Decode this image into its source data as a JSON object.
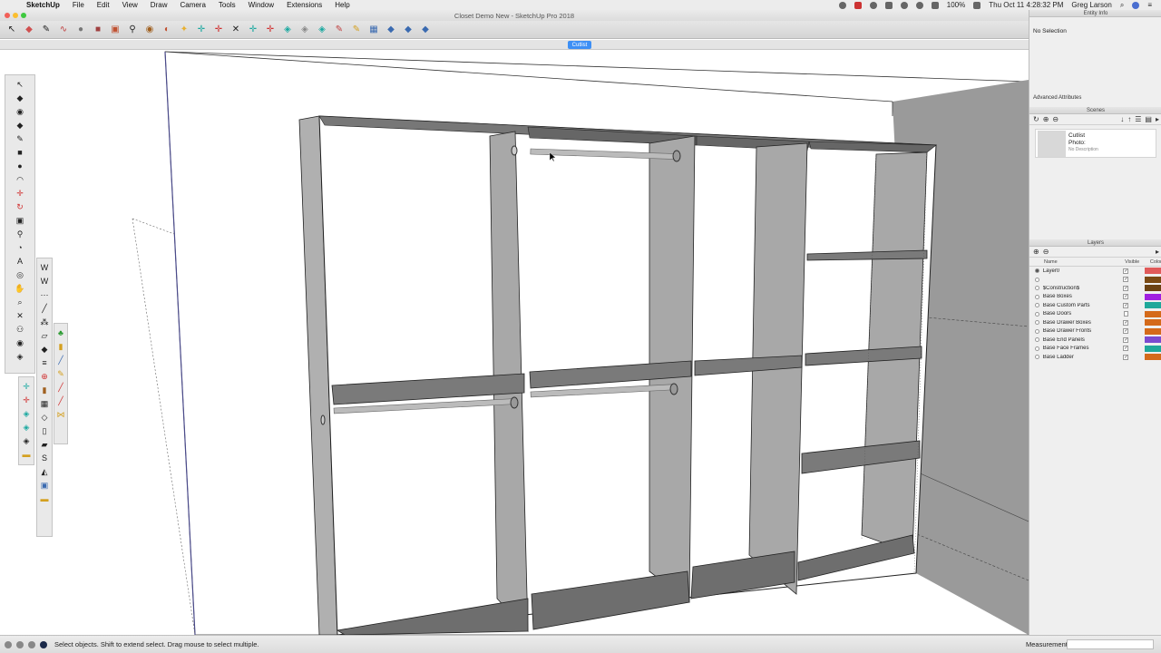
{
  "menubar": {
    "items": [
      {
        "label": "SketchUp",
        "app": true
      },
      {
        "label": "File"
      },
      {
        "label": "Edit"
      },
      {
        "label": "View"
      },
      {
        "label": "Draw"
      },
      {
        "label": "Camera"
      },
      {
        "label": "Tools"
      },
      {
        "label": "Window"
      },
      {
        "label": "Extensions"
      },
      {
        "label": "Help"
      }
    ],
    "battery": "100%",
    "clock": "Thu Oct 11  4:28:32 PM",
    "user": "Greg Larson"
  },
  "window": {
    "title": "Closet Demo New - SketchUp Pro 2018"
  },
  "scene_tab": {
    "label": "Cutlist"
  },
  "tray": {
    "entity_info": {
      "title": "Entity Info",
      "selection": "No Selection",
      "advanced": "Advanced Attributes"
    },
    "scenes": {
      "title": "Scenes",
      "scene_name": "Cutlist",
      "scene_desc": "Photo:",
      "scene_nodesc": "No Description"
    },
    "layers": {
      "title": "Layers",
      "col_name": "Name",
      "col_visible": "Visible",
      "col_color": "Color",
      "rows": [
        {
          "name": "Layer0",
          "visible": true,
          "color": "#e05a5a",
          "active": true
        },
        {
          "name": "",
          "visible": true,
          "color": "#7a4a14",
          "active": false
        },
        {
          "name": "$Construction$",
          "visible": true,
          "color": "#6b4213",
          "active": false
        },
        {
          "name": "Base Boxes",
          "visible": true,
          "color": "#a020e0",
          "active": false
        },
        {
          "name": "Base Custom Parts",
          "visible": true,
          "color": "#1fa89a",
          "active": false
        },
        {
          "name": "Base Doors",
          "visible": false,
          "color": "#d46a1a",
          "active": false
        },
        {
          "name": "Base Drawer Boxes",
          "visible": true,
          "color": "#d46a1a",
          "active": false
        },
        {
          "name": "Base Drawer Fronts",
          "visible": true,
          "color": "#d46a1a",
          "active": false
        },
        {
          "name": "Base End Panels",
          "visible": true,
          "color": "#7a4ad0",
          "active": false
        },
        {
          "name": "Base Face Frames",
          "visible": true,
          "color": "#1fa89a",
          "active": false
        },
        {
          "name": "Base Ladder",
          "visible": true,
          "color": "#d46a1a",
          "active": false
        }
      ]
    }
  },
  "statusbar": {
    "hint": "Select objects. Shift to extend select. Drag mouse to select multiple.",
    "measurements_label": "Measurements"
  }
}
